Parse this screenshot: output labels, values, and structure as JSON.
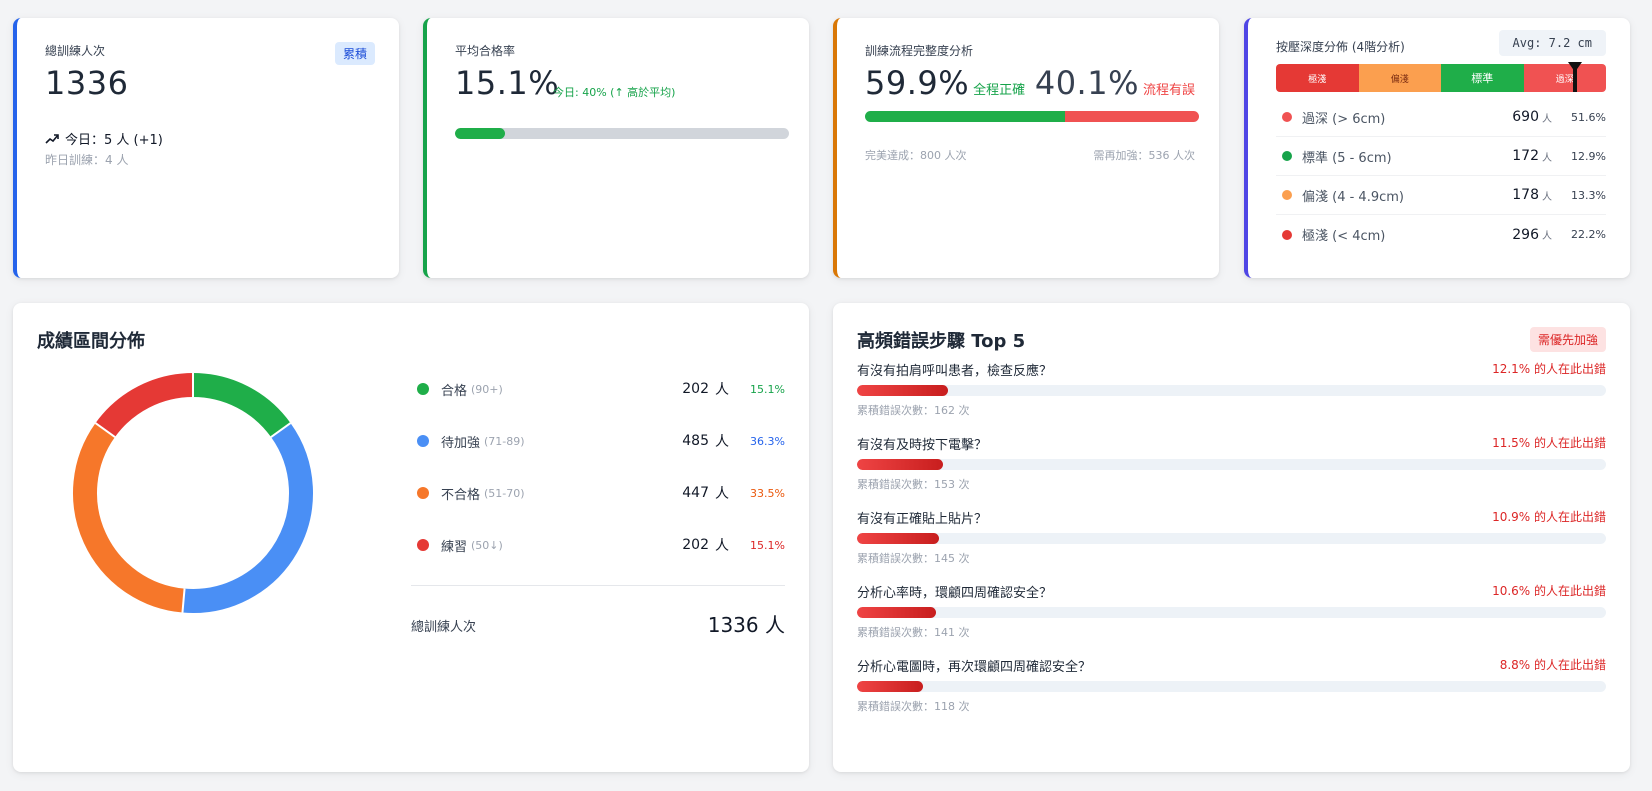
{
  "kpi_total": {
    "label": "總訓練人次",
    "badge": "累積",
    "value": "1336",
    "today_icon": "trend-up-icon",
    "today": "今日：5 人 (+1)",
    "yesterday": "昨日訓練：4 人"
  },
  "kpi_pass": {
    "label": "平均合格率",
    "value": "15.1%",
    "note": "今日: 40% (↑ 高於平均)",
    "progress": 0.151,
    "color": "#1fae49"
  },
  "kpi_flow": {
    "label": "訓練流程完整度分析",
    "ok_pct": "59.9%",
    "ok_tag": "全程正確",
    "bad_pct": "40.1%",
    "bad_tag": "流程有誤",
    "ok_fraction": 0.599,
    "foot_left": "完美達成：800 人次",
    "foot_right": "需再加強：536 人次"
  },
  "kpi_depth": {
    "label": "按壓深度分佈 (4階分析)",
    "avg": "Avg: 7.2 cm",
    "segments": [
      "極淺",
      "偏淺",
      "標準",
      "過深"
    ],
    "marker_fraction": 0.905,
    "rows": [
      {
        "label": "過深 (> 6cm)",
        "count": "690",
        "unit": "人",
        "pct": "51.6%",
        "color": "#f05252"
      },
      {
        "label": "標準 (5 - 6cm)",
        "count": "172",
        "unit": "人",
        "pct": "12.9%",
        "color": "#16a34a"
      },
      {
        "label": "偏淺 (4 - 4.9cm)",
        "count": "178",
        "unit": "人",
        "pct": "13.3%",
        "color": "#fb9f4f"
      },
      {
        "label": "極淺 (< 4cm)",
        "count": "296",
        "unit": "人",
        "pct": "22.2%",
        "color": "#e53935"
      }
    ]
  },
  "score_dist": {
    "title": "成績區間分佈",
    "items": [
      {
        "name": "合格",
        "range": "(90+)",
        "count": "202",
        "unit": "人",
        "pct": "15.1%",
        "value": 15.1,
        "color": "#1fae49",
        "pct_color": "#16a34a"
      },
      {
        "name": "待加強",
        "range": "(71-89)",
        "count": "485",
        "unit": "人",
        "pct": "36.3%",
        "value": 36.3,
        "color": "#4a8ff5",
        "pct_color": "#2563eb"
      },
      {
        "name": "不合格",
        "range": "(51-70)",
        "count": "447",
        "unit": "人",
        "pct": "33.5%",
        "value": 33.5,
        "color": "#f6772a",
        "pct_color": "#ea580c"
      },
      {
        "name": "練習",
        "range": "(50↓)",
        "count": "202",
        "unit": "人",
        "pct": "15.1%",
        "value": 15.1,
        "color": "#e53935",
        "pct_color": "#dc2626"
      }
    ],
    "total_label": "總訓練人次",
    "total_value": "1336 人"
  },
  "top_errors": {
    "title": "高頻錯誤步驟 Top 5",
    "badge": "需優先加強",
    "items": [
      {
        "question": "有沒有拍肩呼叫患者，檢查反應？",
        "rate": "12.1% 的人在此出錯",
        "value": 0.121,
        "sub": "累積錯誤次數：162 次"
      },
      {
        "question": "有沒有及時按下電擊？",
        "rate": "11.5% 的人在此出錯",
        "value": 0.115,
        "sub": "累積錯誤次數：153 次"
      },
      {
        "question": "有沒有正確貼上貼片？",
        "rate": "10.9% 的人在此出錯",
        "value": 0.109,
        "sub": "累積錯誤次數：145 次"
      },
      {
        "question": "分析心率時，環顧四周確認安全？",
        "rate": "10.6% 的人在此出錯",
        "value": 0.106,
        "sub": "累積錯誤次數：141 次"
      },
      {
        "question": "分析心電圖時，再次環顧四周確認安全？",
        "rate": "8.8% 的人在此出錯",
        "value": 0.088,
        "sub": "累積錯誤次數：118 次"
      }
    ]
  }
}
